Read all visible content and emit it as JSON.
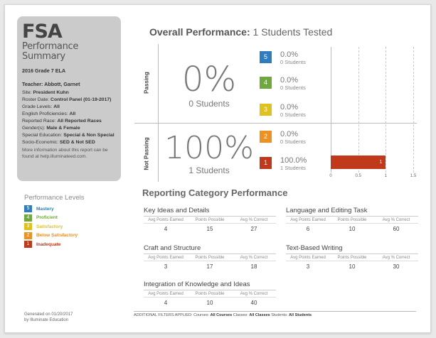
{
  "summary": {
    "title": "FSA",
    "subtitle_1": "Performance",
    "subtitle_2": "Summary",
    "grade_subject": "2016 Grade 7 ELA",
    "teacher": "Teacher: Abbott, Garnet",
    "fields": [
      {
        "label": "Site: ",
        "value": "President Kuhn"
      },
      {
        "label": "Roster Date: ",
        "value": "Control Panel (01-19-2017)"
      },
      {
        "label": "Grade Levels: ",
        "value": "All"
      },
      {
        "label": "English Proficiencies: ",
        "value": "All"
      },
      {
        "label": "Reported Race: ",
        "value": "All Reported Races"
      },
      {
        "label": "Gender(s): ",
        "value": "Male & Female"
      },
      {
        "label": "Special Education: ",
        "value": "Special & Non Special"
      },
      {
        "label": "Socio-Economic: ",
        "value": "SED & Not SED"
      }
    ],
    "info": "More information about this report can be found at help.illuminateed.com."
  },
  "levels": {
    "title": "Performance Levels",
    "items": [
      {
        "num": "5",
        "name": "Mastery",
        "color": "#2f7dc1"
      },
      {
        "num": "4",
        "name": "Proficient",
        "color": "#6fa83b"
      },
      {
        "num": "3",
        "name": "Satisfactory",
        "color": "#e0c21e"
      },
      {
        "num": "2",
        "name": "Below Satisfactory",
        "color": "#f0901e"
      },
      {
        "num": "1",
        "name": "Inadequate",
        "color": "#c0391b"
      }
    ]
  },
  "generated": {
    "line1": "Generated on 01/20/2017",
    "line2": "by Illuminate Education"
  },
  "overall": {
    "label": "Overall Performance:",
    "tested": "1 Students Tested"
  },
  "passing": {
    "label": "Passing",
    "pct": "0%",
    "students": "0 Students"
  },
  "not_passing": {
    "label": "Not Passing",
    "pct": "100%",
    "students": "1 Students"
  },
  "level_rows": [
    {
      "num": "5",
      "pct": "0.0%",
      "students": "0 Students",
      "color": "#2f7dc1"
    },
    {
      "num": "4",
      "pct": "0.0%",
      "students": "0 Students",
      "color": "#6fa83b"
    },
    {
      "num": "3",
      "pct": "0.0%",
      "students": "0 Students",
      "color": "#e0c21e"
    },
    {
      "num": "2",
      "pct": "0.0%",
      "students": "0 Students",
      "color": "#f0901e"
    },
    {
      "num": "1",
      "pct": "100.0%",
      "students": "1 Students",
      "color": "#c0391b"
    }
  ],
  "chart_data": {
    "type": "bar",
    "orientation": "horizontal",
    "categories": [
      "5",
      "4",
      "3",
      "2",
      "1"
    ],
    "values": [
      0,
      0,
      0,
      0,
      1
    ],
    "data_labels": [
      "",
      "",
      "",
      "",
      "1"
    ],
    "xlim": [
      0,
      1.5
    ],
    "ticks": [
      "0",
      "0.5",
      "1",
      "1.5"
    ],
    "grid": true
  },
  "reporting": {
    "title": "Reporting Category Performance",
    "headers": [
      "Avg Points Earned",
      "Points Possible",
      "Avg % Correct"
    ],
    "categories": [
      {
        "name": "Key Ideas and Details",
        "earned": "4",
        "possible": "15",
        "correct": "27"
      },
      {
        "name": "Language and Editing Task",
        "earned": "6",
        "possible": "10",
        "correct": "60"
      },
      {
        "name": "Craft and Structure",
        "earned": "3",
        "possible": "17",
        "correct": "18"
      },
      {
        "name": "Text-Based Writing",
        "earned": "3",
        "possible": "10",
        "correct": "30"
      },
      {
        "name": "Integration of Knowledge and Ideas",
        "earned": "4",
        "possible": "10",
        "correct": "40"
      }
    ]
  },
  "filters": {
    "label": "ADDITIONAL FILTERS APPLIED:",
    "courses_label": "Courses:",
    "courses": "All Courses",
    "classes_label": "Classes:",
    "classes": "All Classes",
    "students_label": "Students:",
    "students": "All Students"
  }
}
